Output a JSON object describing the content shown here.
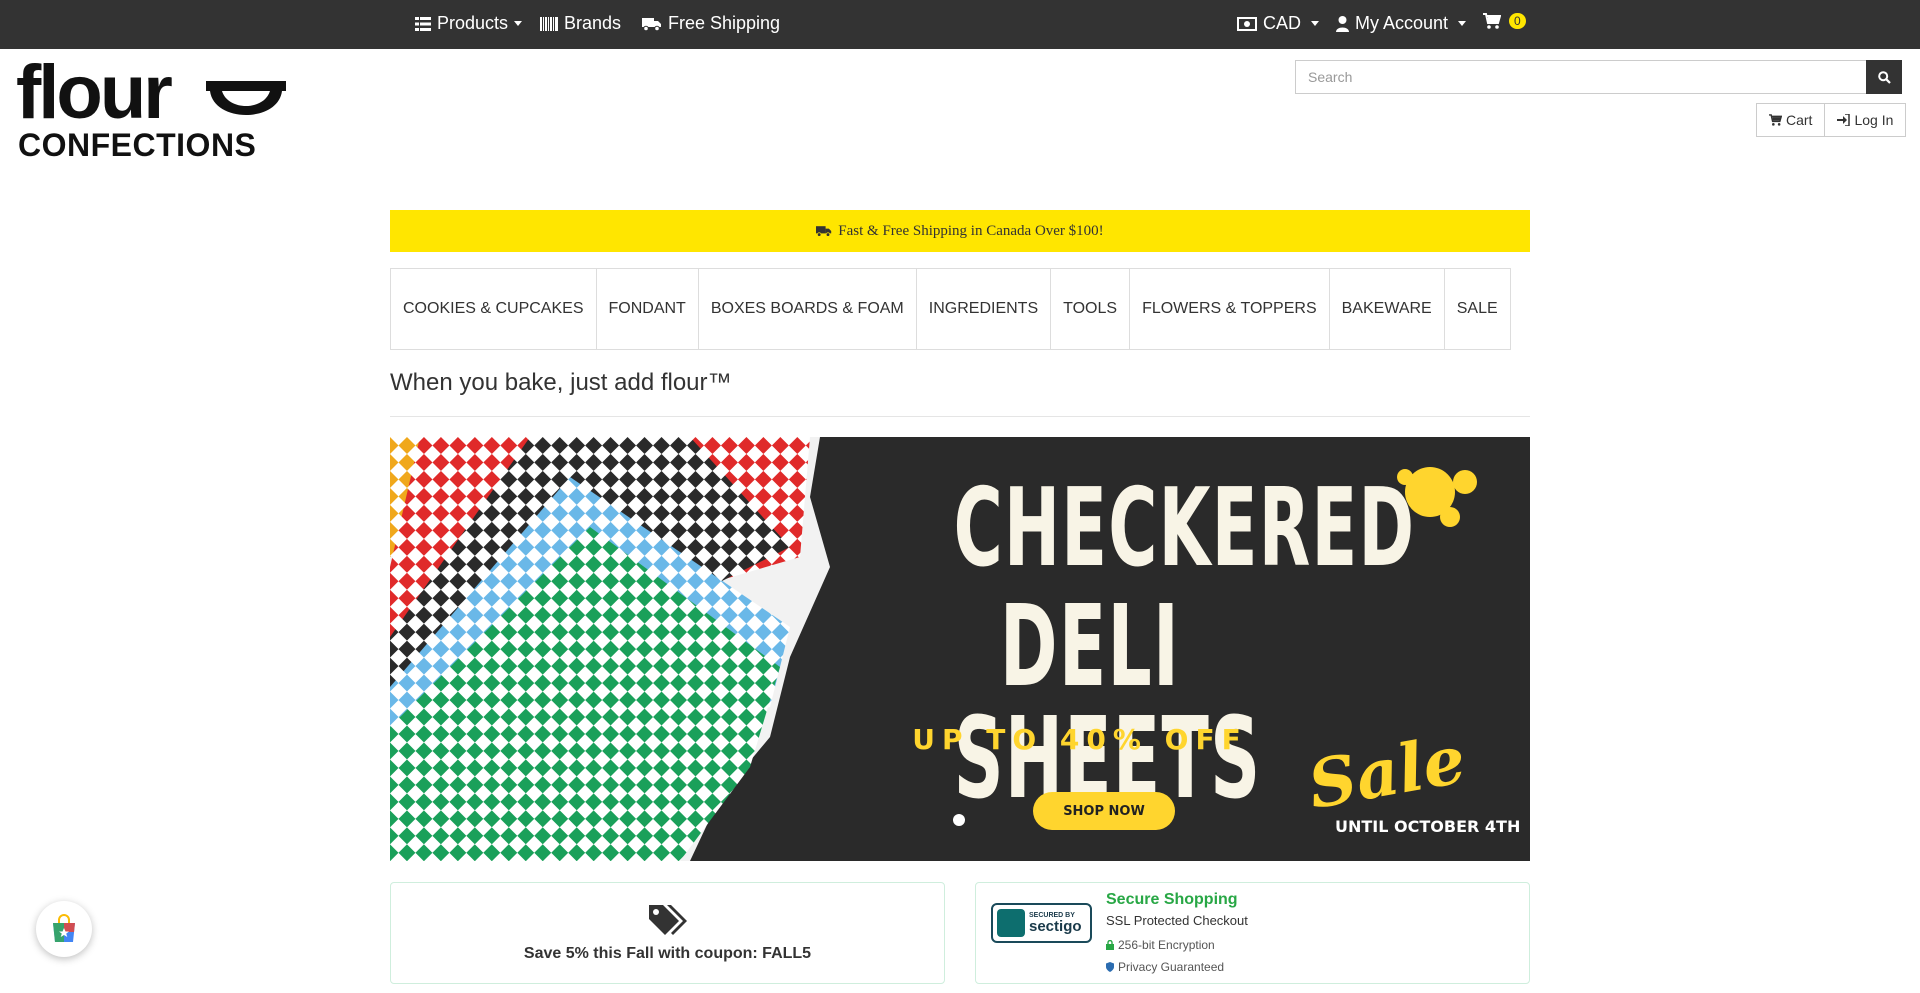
{
  "topbar": {
    "products": "Products",
    "brands": "Brands",
    "free_shipping": "Free Shipping",
    "currency": "CAD",
    "my_account": "My Account",
    "cart_count": "0"
  },
  "logo": {
    "word1": "flour",
    "word2": "CONFECTIONS"
  },
  "search": {
    "placeholder": "Search",
    "value": ""
  },
  "header_buttons": {
    "cart": "Cart",
    "login": "Log In"
  },
  "shipping_banner": "Fast & Free Shipping in Canada Over $100!",
  "categories": [
    "COOKIES & CUPCAKES",
    "FONDANT",
    "BOXES BOARDS & FOAM",
    "INGREDIENTS",
    "TOOLS",
    "FLOWERS & TOPPERS",
    "BAKEWARE",
    "SALE"
  ],
  "tagline": "When you bake, just add flour™",
  "hero": {
    "line1": "CHECKERED",
    "line2": "DELI SHEETS",
    "sub": "UP TO 40% OFF",
    "cta": "SHOP NOW",
    "sale": "Sale",
    "until": "UNTIL OCTOBER 4TH"
  },
  "coupon": "Save 5% this Fall with coupon: FALL5",
  "secure": {
    "badge_small": "SECURED BY",
    "badge_brand": "sectigo",
    "title": "Secure Shopping",
    "subtitle": "SSL Protected Checkout",
    "line1": "256-bit Encryption",
    "line2": "Privacy Guaranteed"
  },
  "colors": {
    "topbar": "#333333",
    "banner_yellow": "#ffe600",
    "secure_green": "#28a745"
  }
}
